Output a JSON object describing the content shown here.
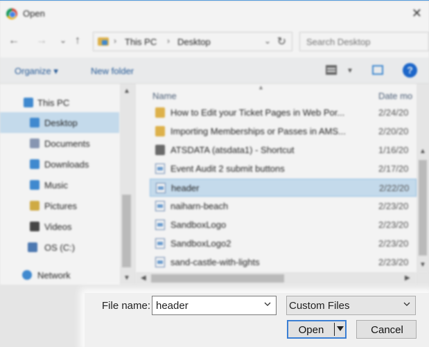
{
  "window": {
    "title": "Open",
    "close_glyph": "✕"
  },
  "nav": {
    "back_glyph": "←",
    "forward_glyph": "→",
    "recent_glyph": "⌄",
    "up_glyph": "↑",
    "breadcrumb": [
      "This PC",
      "Desktop"
    ],
    "search_placeholder": "Search Desktop"
  },
  "toolbar": {
    "organize_label": "Organize ▾",
    "new_folder_label": "New folder",
    "help_glyph": "?"
  },
  "sidebar": {
    "items": [
      {
        "label": "This PC",
        "icon": "computer-icon",
        "color": "#3c8cd8"
      },
      {
        "label": "Desktop",
        "icon": "desktop-icon",
        "color": "#3c8cd8"
      },
      {
        "label": "Documents",
        "icon": "documents-icon",
        "color": "#8a9ab8"
      },
      {
        "label": "Downloads",
        "icon": "downloads-icon",
        "color": "#3c8cd8"
      },
      {
        "label": "Music",
        "icon": "music-icon",
        "color": "#3c8cd8"
      },
      {
        "label": "Pictures",
        "icon": "pictures-icon",
        "color": "#d8b040"
      },
      {
        "label": "Videos",
        "icon": "videos-icon",
        "color": "#444"
      },
      {
        "label": "OS (C:)",
        "icon": "drive-icon",
        "color": "#4a7ab8"
      },
      {
        "label": "Network",
        "icon": "network-icon",
        "color": "#3c8cd8"
      }
    ]
  },
  "files": {
    "col_name": "Name",
    "col_date": "Date mo",
    "rows": [
      {
        "name": "How to Edit your Ticket Pages in Web Por...",
        "date": "2/24/20",
        "type": "folder"
      },
      {
        "name": "Importing Memberships or Passes in AMS...",
        "date": "2/20/20",
        "type": "folder"
      },
      {
        "name": "ATSDATA (atsdata1) - Shortcut",
        "date": "1/16/20",
        "type": "shortcut"
      },
      {
        "name": "Event Audit 2 submit buttons",
        "date": "2/17/20",
        "type": "file"
      },
      {
        "name": "header",
        "date": "2/22/20",
        "type": "file"
      },
      {
        "name": "naiharn-beach",
        "date": "2/23/20",
        "type": "file"
      },
      {
        "name": "SandboxLogo",
        "date": "2/23/20",
        "type": "file"
      },
      {
        "name": "SandboxLogo2",
        "date": "2/23/20",
        "type": "file"
      },
      {
        "name": "sand-castle-with-lights",
        "date": "2/23/20",
        "type": "file"
      }
    ]
  },
  "bottom": {
    "file_name_label": "File name:",
    "file_name_value": "header",
    "filter_value": "Custom Files",
    "open_label": "Open",
    "cancel_label": "Cancel"
  }
}
